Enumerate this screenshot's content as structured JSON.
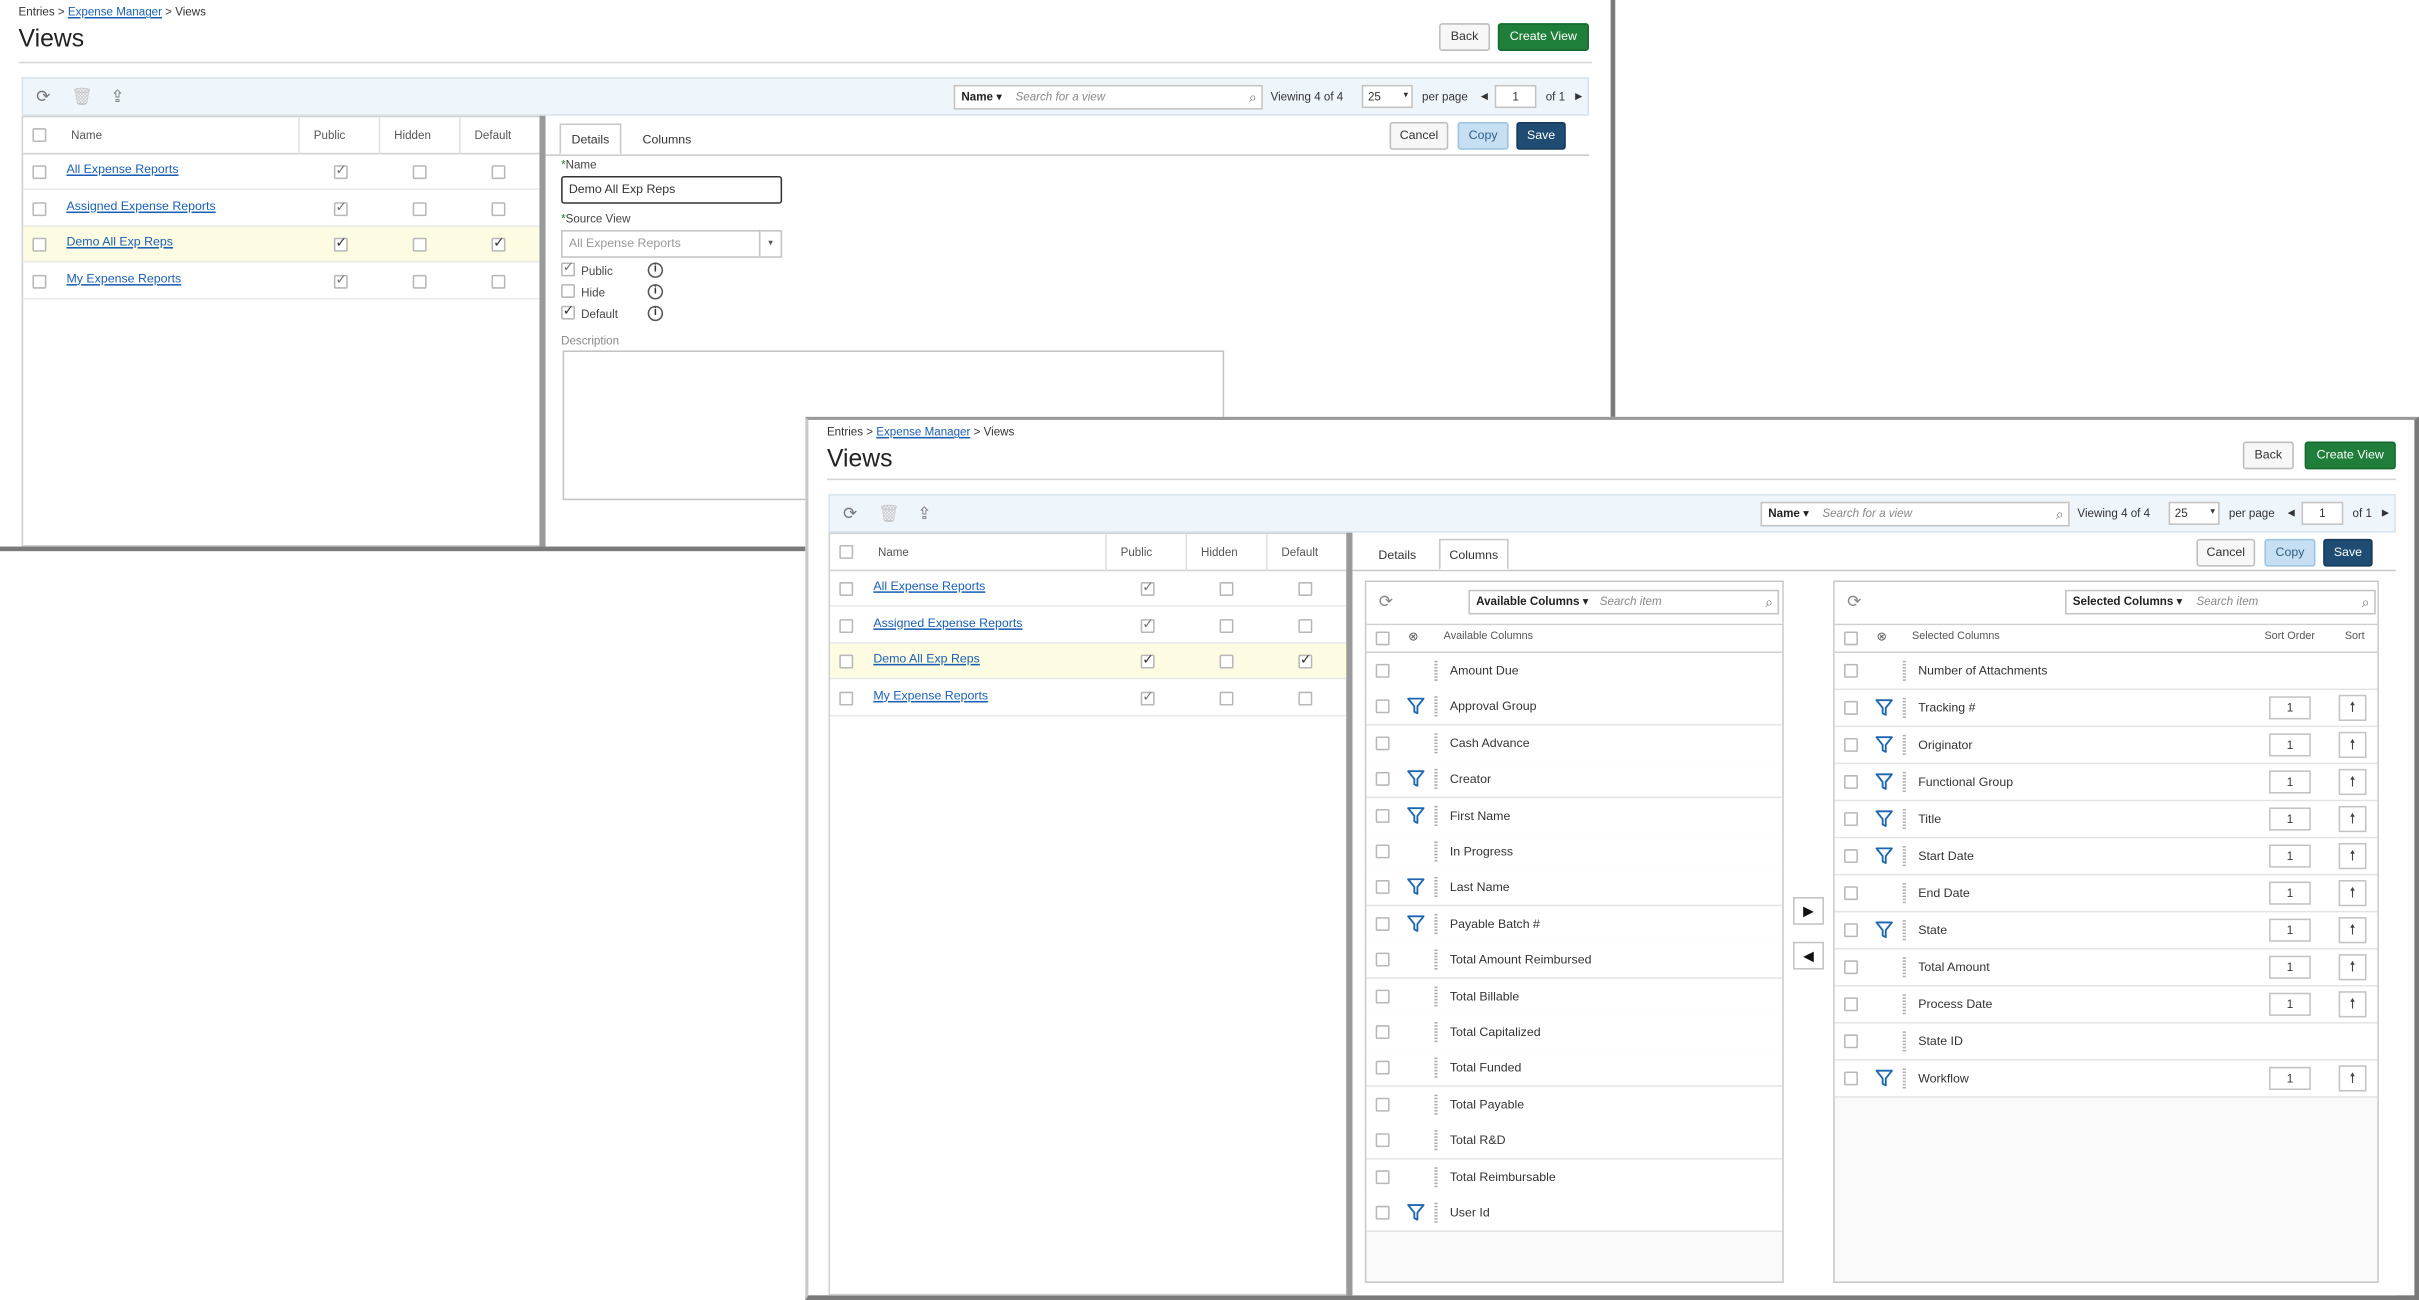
{
  "breadcrumb": {
    "root": "Entries",
    "sep1": " > ",
    "middle": "Expense Manager",
    "sep2": " > ",
    "current": "Views"
  },
  "page_title": "Views",
  "buttons": {
    "back": "Back",
    "create_view": "Create View",
    "cancel": "Cancel",
    "copy": "Copy",
    "save": "Save"
  },
  "search": {
    "field": "Name",
    "placeholder": "Search for a view"
  },
  "pager": {
    "viewing_label": "Viewing",
    "count": "4 of 4",
    "per_page_value": "25",
    "per_page_label": "per page",
    "page": "1",
    "of_label": "of 1"
  },
  "grid": {
    "headers": {
      "name": "Name",
      "public": "Public",
      "hidden": "Hidden",
      "default": "Default"
    },
    "rows": [
      {
        "name": "All Expense Reports",
        "public": true,
        "hidden": false,
        "default": false
      },
      {
        "name": "Assigned Expense Reports",
        "public": true,
        "hidden": false,
        "default": false
      },
      {
        "name": "Demo All Exp Reps",
        "public": true,
        "hidden": false,
        "default": true,
        "selected": true
      },
      {
        "name": "My Expense Reports",
        "public": true,
        "hidden": false,
        "default": false
      }
    ]
  },
  "tabs": {
    "details": "Details",
    "columns": "Columns"
  },
  "details": {
    "name_label": "Name",
    "name_value": "Demo All Exp Reps",
    "source_label": "Source View",
    "source_value": "All Expense Reports",
    "public_label": "Public",
    "hide_label": "Hide",
    "default_label": "Default",
    "description_label": "Description"
  },
  "columns_tab": {
    "available": {
      "dropdown": "Available Columns",
      "placeholder": "Search item",
      "header": "Available Columns",
      "items": [
        {
          "name": "Amount Due",
          "filter": false
        },
        {
          "name": "Approval Group",
          "filter": true
        },
        {
          "name": "Cash Advance",
          "filter": false
        },
        {
          "name": "Creator",
          "filter": true
        },
        {
          "name": "First Name",
          "filter": true
        },
        {
          "name": "In Progress",
          "filter": false
        },
        {
          "name": "Last Name",
          "filter": true
        },
        {
          "name": "Payable Batch #",
          "filter": true
        },
        {
          "name": "Total Amount Reimbursed",
          "filter": false
        },
        {
          "name": "Total Billable",
          "filter": false
        },
        {
          "name": "Total Capitalized",
          "filter": false
        },
        {
          "name": "Total Funded",
          "filter": false
        },
        {
          "name": "Total Payable",
          "filter": false
        },
        {
          "name": "Total R&D",
          "filter": false
        },
        {
          "name": "Total Reimbursable",
          "filter": false
        },
        {
          "name": "User Id",
          "filter": true
        }
      ]
    },
    "selected": {
      "dropdown": "Selected Columns",
      "placeholder": "Search item",
      "header": "Selected Columns",
      "sort_order_header": "Sort Order",
      "sort_header": "Sort",
      "items": [
        {
          "name": "Number of Attachments",
          "filter": false,
          "sort": ""
        },
        {
          "name": "Tracking #",
          "filter": true,
          "sort": "1"
        },
        {
          "name": "Originator",
          "filter": true,
          "sort": "1"
        },
        {
          "name": "Functional Group",
          "filter": true,
          "sort": "1"
        },
        {
          "name": "Title",
          "filter": true,
          "sort": "1"
        },
        {
          "name": "Start Date",
          "filter": true,
          "sort": "1"
        },
        {
          "name": "End Date",
          "filter": false,
          "sort": "1"
        },
        {
          "name": "State",
          "filter": true,
          "sort": "1"
        },
        {
          "name": "Total Amount",
          "filter": false,
          "sort": "1"
        },
        {
          "name": "Process Date",
          "filter": false,
          "sort": "1"
        },
        {
          "name": "State ID",
          "filter": false,
          "sort": ""
        },
        {
          "name": "Workflow",
          "filter": true,
          "sort": "1"
        }
      ]
    }
  },
  "colors": {
    "green": "#1f7e3a",
    "navy": "#1e4c72",
    "link": "#1a5fb4",
    "selected_row": "#fdfbe1",
    "toolbar": "#eef5fb"
  }
}
